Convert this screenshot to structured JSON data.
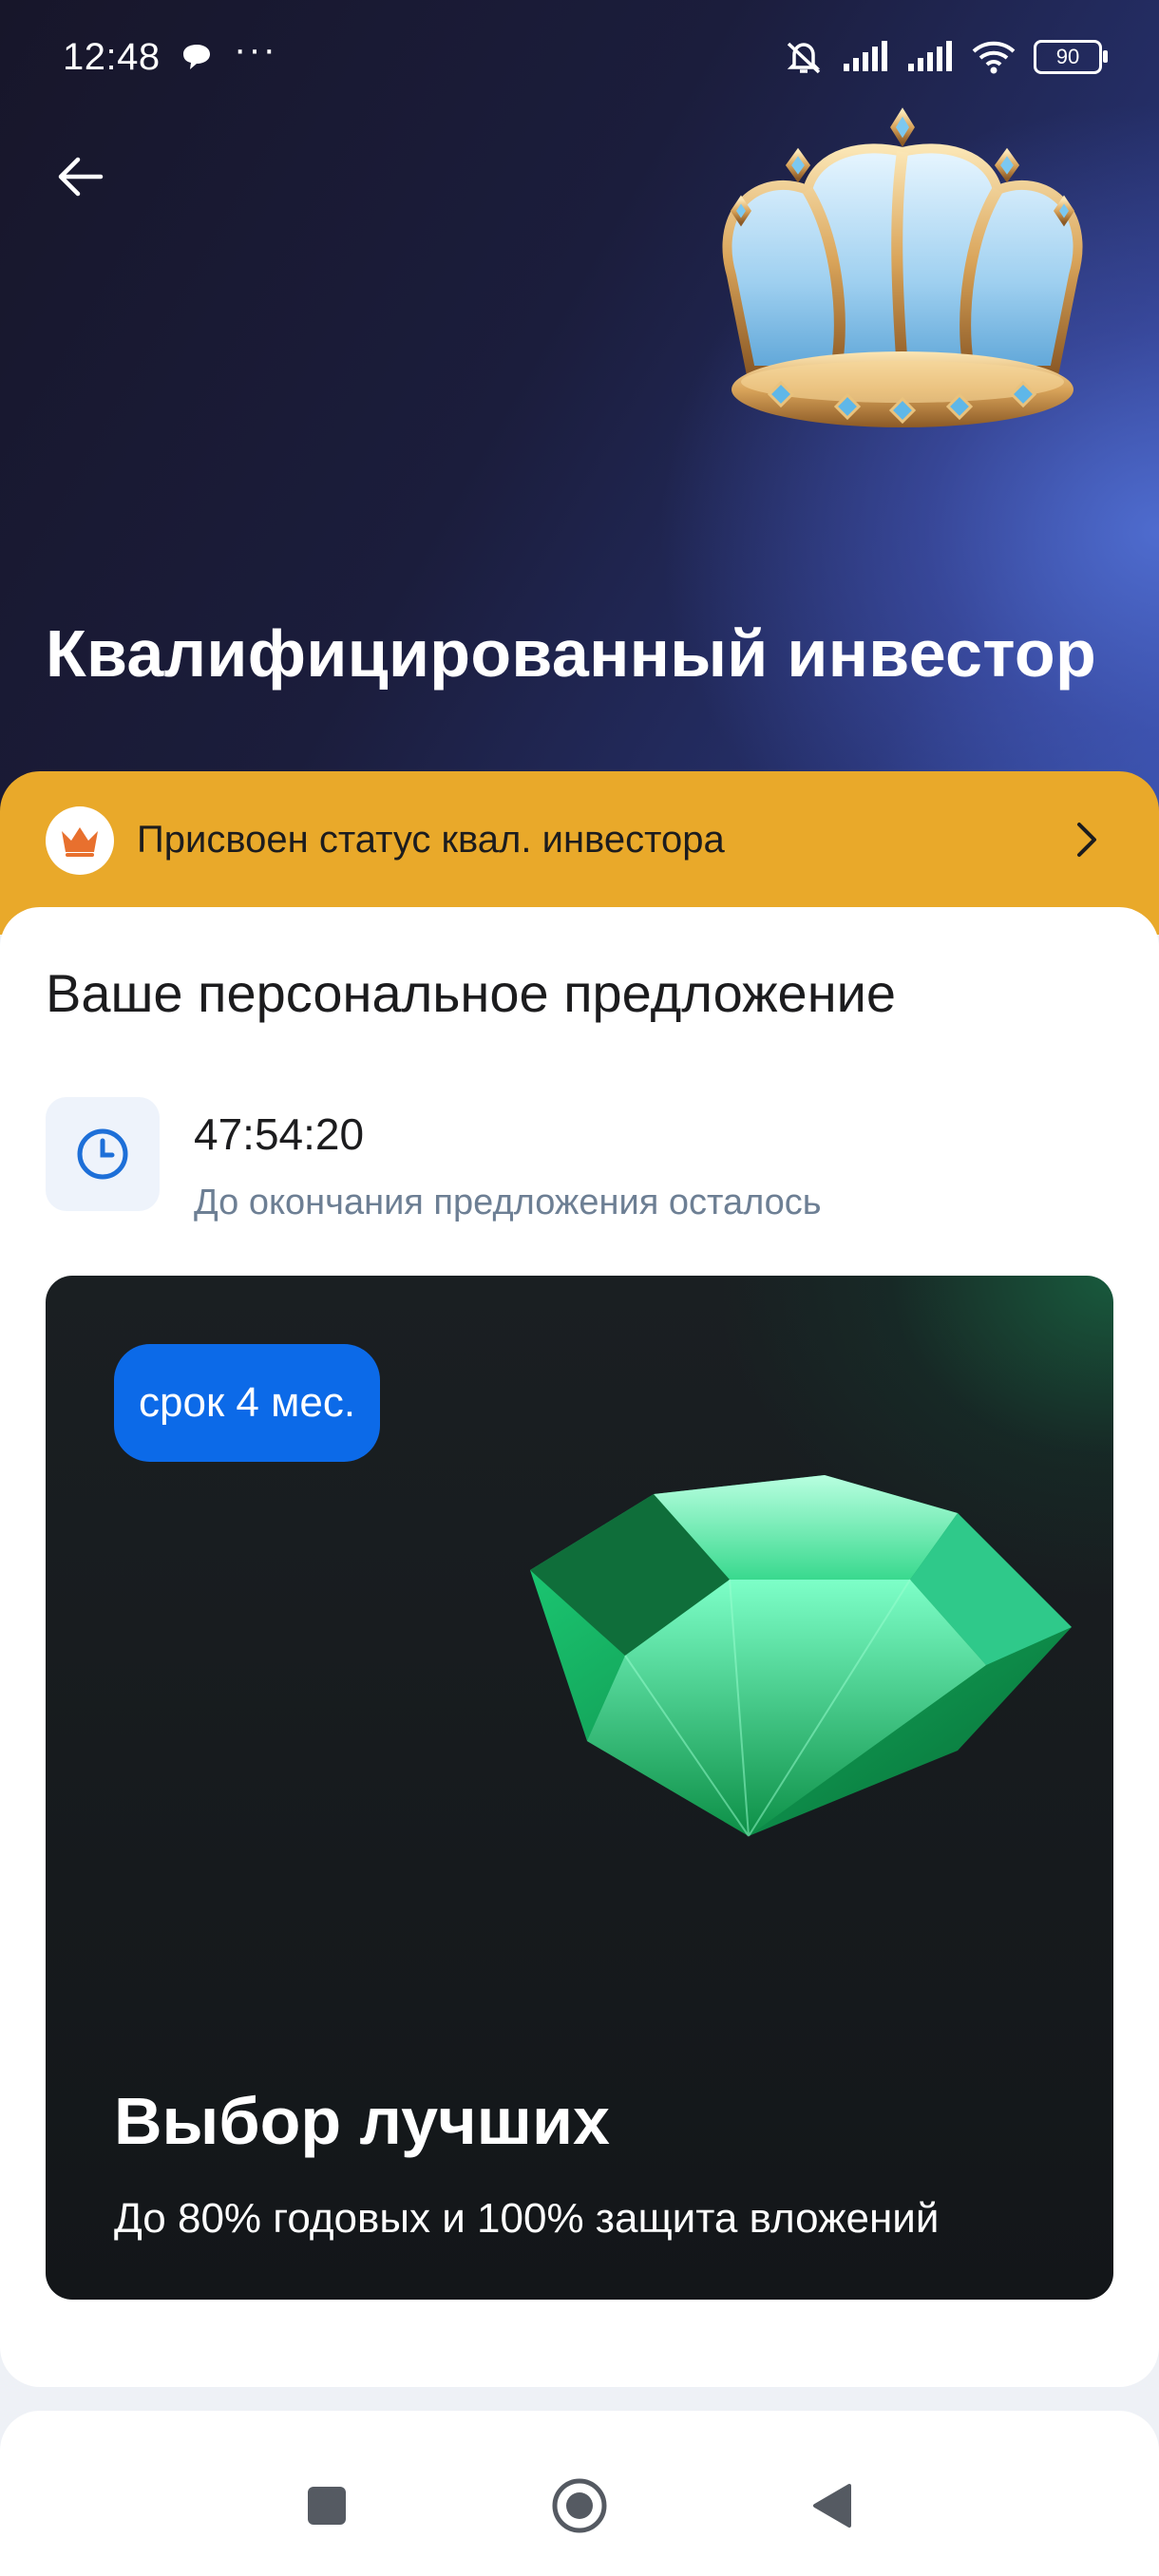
{
  "status_bar": {
    "time": "12:48",
    "overflow": "···",
    "battery": "90",
    "icons": [
      "chat-bubble-icon",
      "mute-icon",
      "signal-icon",
      "signal-icon",
      "wifi-icon",
      "battery-icon"
    ]
  },
  "header": {
    "back_icon": "arrow-left-icon",
    "title": "Квалифицированный инвестор",
    "illustration": "crown"
  },
  "status_strip": {
    "icon": "crown-icon",
    "text": "Присвоен статус квал. инвестора",
    "chevron": "chevron-right-icon"
  },
  "offer_section": {
    "title": "Ваше персональное предложение",
    "timer": {
      "icon": "clock-icon",
      "value": "47:54:20",
      "label": "До окончания предложения осталось"
    },
    "card": {
      "badge": "срок 4 мес.",
      "illustration": "emerald",
      "title": "Выбор лучших",
      "subtitle": "До 80% годовых и 100% защита вложений"
    }
  },
  "system_nav": {
    "items": [
      "recents-square-icon",
      "home-circle-icon",
      "back-triangle-icon"
    ]
  },
  "colors": {
    "strip": "#e9a92a",
    "badge": "#0c6ae8",
    "timer_label": "#6d7f94",
    "hero_dark": "#17162a",
    "hero_blue": "#3550a8"
  }
}
